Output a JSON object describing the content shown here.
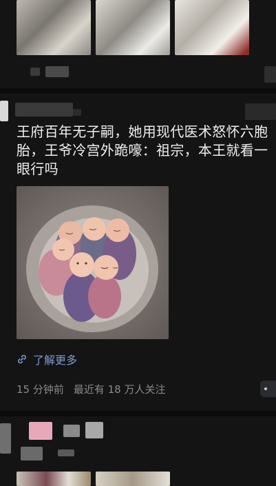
{
  "post": {
    "text": "王府百年无子嗣，她用现代医术怒怀六胞胎，王爷冷宫外跪嚎：祖宗，本王就看一眼行吗",
    "link_label": "了解更多",
    "time": "15 分钟前",
    "followers": "最近有 18 万人关注"
  },
  "icons": {
    "link": "link-icon",
    "more": "more-options-icon"
  },
  "colors": {
    "background": "#141414",
    "link": "#7e9ccf",
    "meta": "#8a8a8a"
  }
}
